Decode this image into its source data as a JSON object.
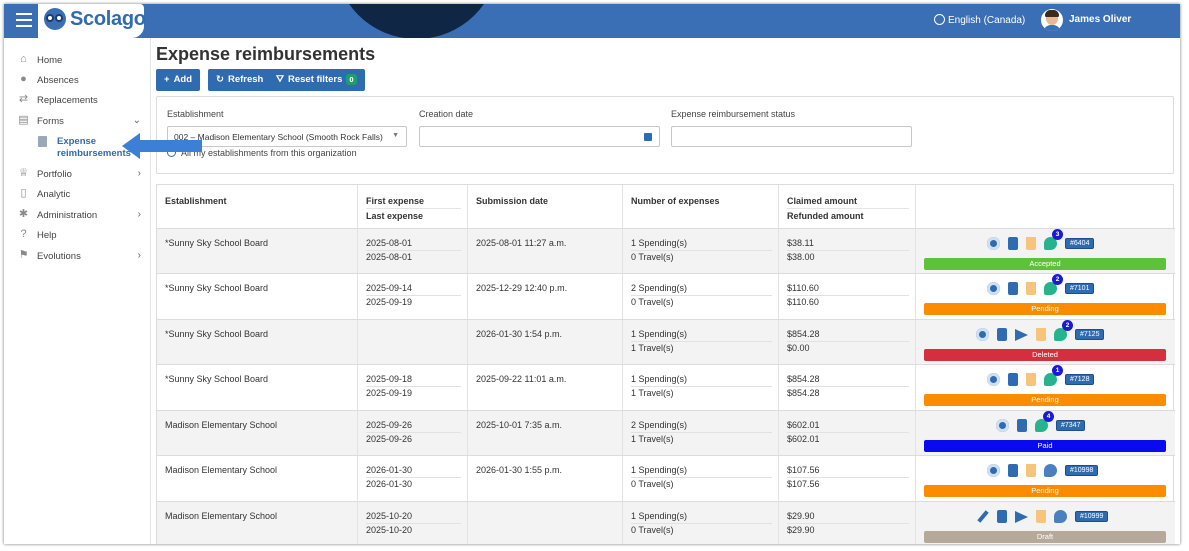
{
  "app": {
    "logo": "Scolago",
    "language": "English (Canada)",
    "user": "James Oliver"
  },
  "sidebar": {
    "items": [
      {
        "label": "Home",
        "icon": "home-icon"
      },
      {
        "label": "Absences",
        "icon": "users-icon"
      },
      {
        "label": "Replacements",
        "icon": "swap-icon"
      },
      {
        "label": "Forms",
        "icon": "form-icon",
        "chevron": "⌄"
      },
      {
        "label": "Portfolio",
        "icon": "trophy-icon",
        "chevron": "›"
      },
      {
        "label": "Analytic",
        "icon": "document-icon"
      },
      {
        "label": "Administration",
        "icon": "gear-icon",
        "chevron": "›"
      },
      {
        "label": "Help",
        "icon": "question-icon"
      },
      {
        "label": "Evolutions",
        "icon": "signpost-icon",
        "chevron": "›"
      }
    ],
    "subitem": "Expense reimbursements"
  },
  "page": {
    "title": "Expense reimbursements",
    "buttons": {
      "add": "Add",
      "refresh": "Refresh",
      "reset": "Reset filters",
      "reset_count": "0"
    }
  },
  "filters": {
    "establishment_label": "Establishment",
    "establishment_value": "002 – Madison Elementary School (Smooth Rock Falls)",
    "creation_label": "Creation date",
    "creation_value": "",
    "status_label": "Expense reimbursement status",
    "status_value": "",
    "checkbox_label": "All my establishments from this organization"
  },
  "table": {
    "headers": {
      "establishment": "Establishment",
      "first_expense": "First expense",
      "last_expense": "Last expense",
      "submission": "Submission date",
      "number": "Number of expenses",
      "claimed": "Claimed amount",
      "refunded": "Refunded amount"
    },
    "rows": [
      {
        "establishment": "*Sunny Sky School Board",
        "first": "2025-08-01",
        "last": "2025-08-01",
        "submission": "2025-08-01 11:27 a.m.",
        "spending": "1 Spending(s)",
        "travel": "0 Travel(s)",
        "claimed": "$38.11",
        "refunded": "$38.00",
        "comments": "3",
        "ref": "#6404",
        "status": "Accepted",
        "status_color": "#5dc23a"
      },
      {
        "establishment": "*Sunny Sky School Board",
        "first": "2025-09-14",
        "last": "2025-09-19",
        "submission": "2025-12-29 12:40 p.m.",
        "spending": "2 Spending(s)",
        "travel": "0 Travel(s)",
        "claimed": "$110.60",
        "refunded": "$110.60",
        "comments": "2",
        "ref": "#7101",
        "status": "Pending",
        "status_color": "#fb8c00"
      },
      {
        "establishment": "*Sunny Sky School Board",
        "first": "",
        "last": "",
        "submission": "2026-01-30 1:54 p.m.",
        "spending": "1 Spending(s)",
        "travel": "1 Travel(s)",
        "claimed": "$854.28",
        "refunded": "$0.00",
        "comments": "2",
        "ref": "#7125",
        "status": "Deleted",
        "status_color": "#d32f3f"
      },
      {
        "establishment": "*Sunny Sky School Board",
        "first": "2025-09-18",
        "last": "2025-09-19",
        "submission": "2025-09-22 11:01 a.m.",
        "spending": "1 Spending(s)",
        "travel": "1 Travel(s)",
        "claimed": "$854.28",
        "refunded": "$854.28",
        "comments": "1",
        "ref": "#7128",
        "status": "Pending",
        "status_color": "#fb8c00"
      },
      {
        "establishment": "Madison Elementary School",
        "first": "2025-09-26",
        "last": "2025-09-26",
        "submission": "2025-10-01 7:35 a.m.",
        "spending": "2 Spending(s)",
        "travel": "1 Travel(s)",
        "claimed": "$602.01",
        "refunded": "$602.01",
        "comments": "4",
        "ref": "#7347",
        "status": "Paid",
        "status_color": "#0a0af0"
      },
      {
        "establishment": "Madison Elementary School",
        "first": "2026-01-30",
        "last": "2026-01-30",
        "submission": "2026-01-30 1:55 p.m.",
        "spending": "1 Spending(s)",
        "travel": "0 Travel(s)",
        "claimed": "$107.56",
        "refunded": "$107.56",
        "comments": "",
        "ref": "#10998",
        "status": "Pending",
        "status_color": "#fb8c00"
      },
      {
        "establishment": "Madison Elementary School",
        "first": "2025-10-20",
        "last": "2025-10-20",
        "submission": "",
        "spending": "1 Spending(s)",
        "travel": "0 Travel(s)",
        "claimed": "$29.90",
        "refunded": "$29.90",
        "comments": "",
        "ref": "#10999",
        "status": "Draft",
        "status_color": "#b7a99a"
      }
    ]
  }
}
